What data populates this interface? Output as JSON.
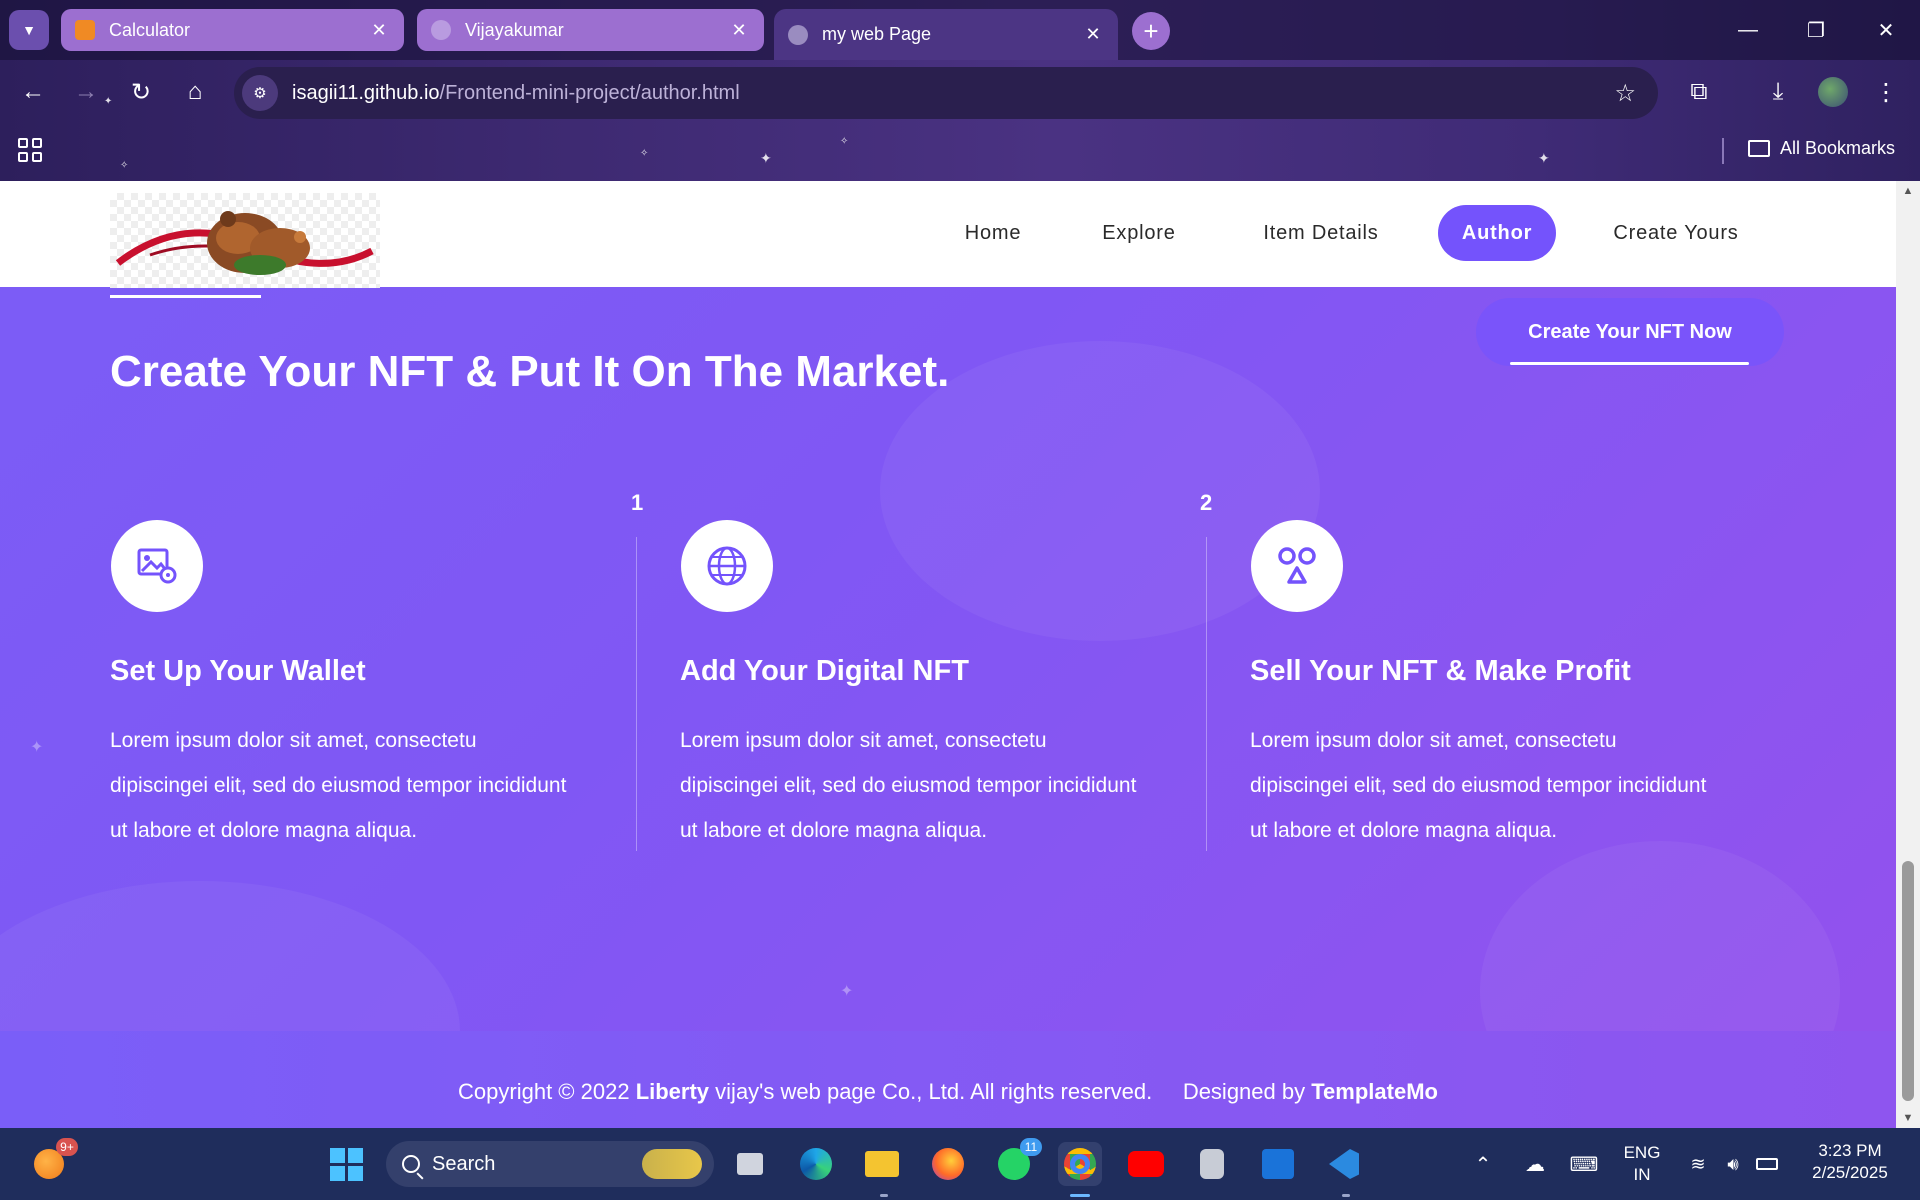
{
  "browser": {
    "tabs": [
      {
        "title": "Calculator",
        "state": "inactive"
      },
      {
        "title": "Vijayakumar",
        "state": "inactive"
      },
      {
        "title": "my web Page",
        "state": "active"
      }
    ],
    "close_glyph": "✕",
    "new_tab_glyph": "+",
    "url_host": "isagii11.github.io",
    "url_path": "/Frontend-mini-project/author.html",
    "bookmarks_label": "All Bookmarks",
    "window_controls": {
      "minimize": "—",
      "restore": "❐",
      "close": "✕"
    }
  },
  "site": {
    "nav": [
      "Home",
      "Explore",
      "Item Details",
      "Author",
      "Create Yours"
    ],
    "active_nav": "Author",
    "cta_label": "Create Your NFT Now",
    "hero_title": "Create Your NFT & Put It On The Market.",
    "steps": [
      {
        "number": "",
        "icon": "image-gear-icon",
        "title": "Set Up Your Wallet",
        "description": "Lorem ipsum dolor sit amet, consectetu dipiscingei elit, sed do eiusmod tempor incididunt ut labore et dolore magna aliqua."
      },
      {
        "number": "1",
        "icon": "globe-icon",
        "title": "Add Your Digital NFT",
        "description": "Lorem ipsum dolor sit amet, consectetu dipiscingei elit, sed do eiusmod tempor incididunt ut labore et dolore magna aliqua."
      },
      {
        "number": "2",
        "icon": "shapes-icon",
        "title": "Sell Your NFT & Make Profit",
        "description": "Lorem ipsum dolor sit amet, consectetu dipiscingei elit, sed do eiusmod tempor incididunt ut labore et dolore magna aliqua."
      }
    ],
    "footer": {
      "copyright_prefix": "Copyright © 2022",
      "brand": "Liberty",
      "copyright_suffix": "vijay's web page Co., Ltd. All rights reserved.",
      "designed_by": "Designed by",
      "designer": "TemplateMo"
    },
    "colors": {
      "accent": "#7453fc",
      "gradient_start": "#7b5df6",
      "gradient_end": "#9451ec"
    }
  },
  "taskbar": {
    "notification_badge": "9+",
    "search_placeholder": "Search",
    "whatsapp_badge": "11",
    "language_line1": "ENG",
    "language_line2": "IN",
    "time": "3:23 PM",
    "date": "2/25/2025"
  }
}
